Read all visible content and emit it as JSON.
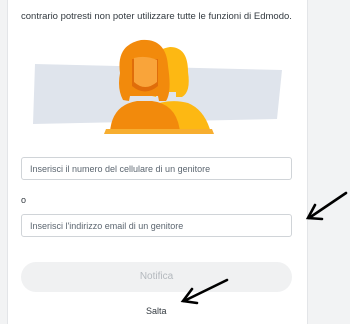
{
  "intro_text": "contrario potresti non poter utilizzare tutte le funzioni di Edmodo.",
  "illustration": {
    "name": "parent-silhouettes",
    "colors": {
      "backdrop": "#dfe4ec",
      "front_person": "#f28a0c",
      "back_person": "#fdb813",
      "dark_accent": "#e06d0a",
      "ground": "#f7ae30"
    }
  },
  "phone_field": {
    "placeholder": "Inserisci il numero del cellulare di un genitore"
  },
  "or_label": "o",
  "email_field": {
    "placeholder": "Inserisci l'indirizzo email di un genitore"
  },
  "notify_button": {
    "label": "Notifica"
  },
  "skip_link": {
    "label": "Salta"
  },
  "annotations": {
    "arrow_color": "#000000"
  }
}
